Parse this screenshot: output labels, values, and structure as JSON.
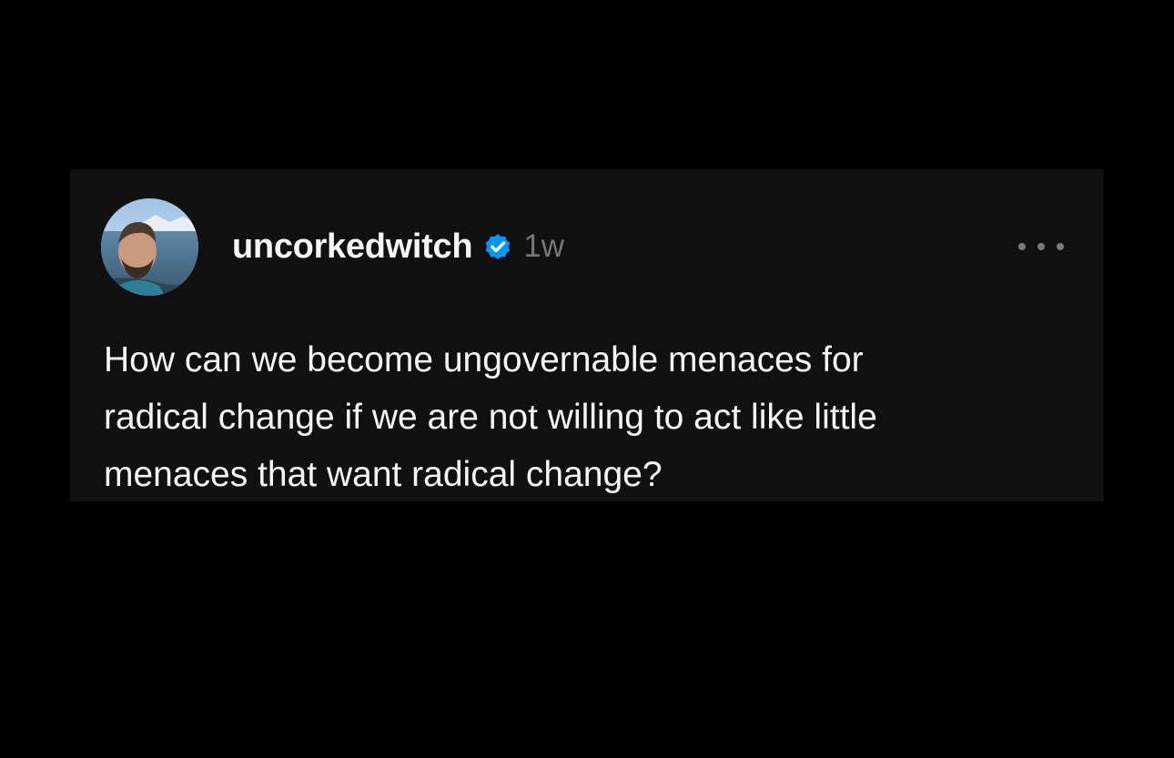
{
  "post": {
    "username": "uncorkedwitch",
    "verified_icon": "verified-badge-icon",
    "timestamp": "1w",
    "more_icon": "more-options-icon",
    "text_lines": [
      "How can we become ungovernable menaces for",
      "radical change if we are not willing to act like little",
      "menaces that want radical change?"
    ]
  },
  "colors": {
    "page_background": "#000000",
    "card_background": "#101010",
    "primary_text": "#f3f5f7",
    "secondary_text": "#777777",
    "verified_badge": "#0095f6"
  }
}
